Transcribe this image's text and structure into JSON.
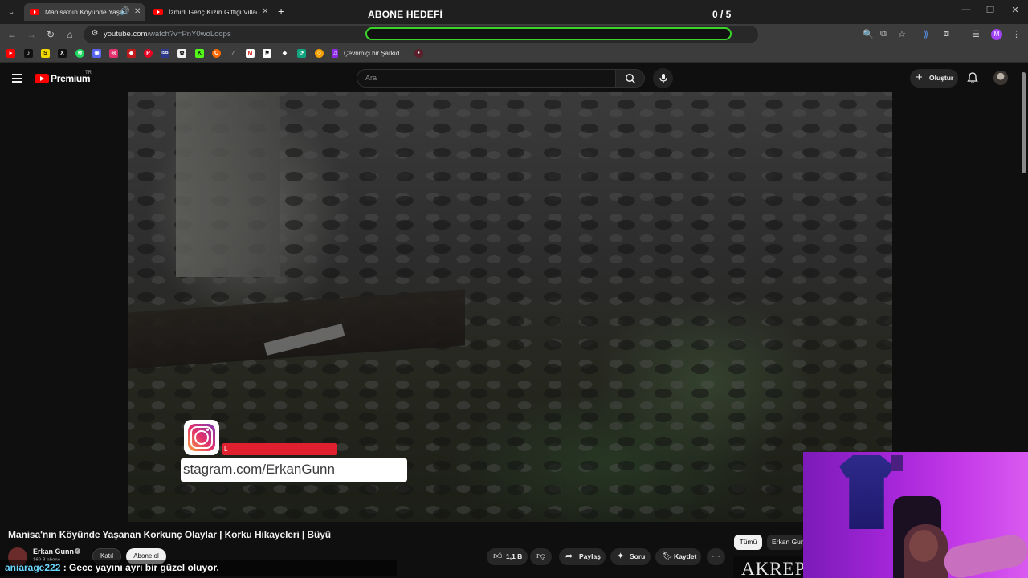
{
  "browser": {
    "tabs": [
      {
        "title": "Manisa'nın Köyünde Yaşanan Korkunç Olaylar",
        "active": true,
        "audio": true
      },
      {
        "title": "İzmirli Genç Kızın Gittiği Villada",
        "active": false,
        "audio": false
      }
    ],
    "new_tab_label": "+",
    "url_host": "youtube.com",
    "url_path": "/watch?v=PnY0woLoops",
    "bookmark_label": "Çevrimiçi bir Şarkıd..."
  },
  "overlay_goal": {
    "title": "ABONE HEDEFİ",
    "count": "0 / 5",
    "progress_fraction": 0.0,
    "color": "#3bd42b"
  },
  "youtube": {
    "brand": "Premium",
    "country": "TR",
    "search_placeholder": "Ara",
    "create_label": "Oluştur"
  },
  "video": {
    "title": "Manisa'nın Köyünde Yaşanan Korkunç Olaylar | Korku Hikayeleri | Büyü",
    "instagram_text": "stagram.com/ErkanGunn",
    "instagram_redbar_text": "L"
  },
  "channel": {
    "name": "Erkan Gunn",
    "subscribers": "169 B abone",
    "join_label": "Katıl",
    "subscribe_label": "Abone ol"
  },
  "actions": {
    "like_count": "1,1 B",
    "share_label": "Paylaş",
    "ask_label": "Soru",
    "save_label": "Kaydet",
    "more_label": "⋯"
  },
  "chips": {
    "all": "Tümü",
    "channel": "Erkan Gun"
  },
  "thumbnail_text": "AKREP",
  "chat": {
    "user": "aniarage222",
    "message": " : Gece yayını ayrı bir güzel oluyor."
  },
  "colors": {
    "youtube_red": "#ff0000",
    "chat_user": "#6ad7ff",
    "webcam_light": "#b02ee0"
  }
}
